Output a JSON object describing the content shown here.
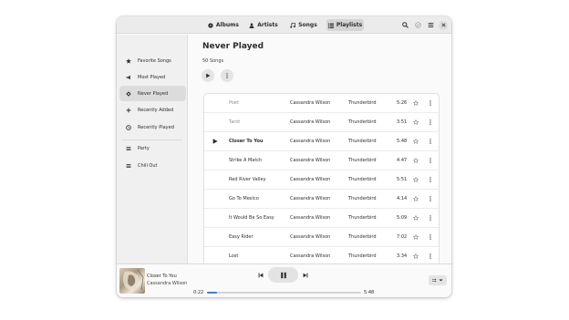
{
  "header": {
    "tabs": [
      {
        "label": "Albums",
        "icon": "album-icon"
      },
      {
        "label": "Artists",
        "icon": "artist-icon"
      },
      {
        "label": "Songs",
        "icon": "songs-icon"
      },
      {
        "label": "Playlists",
        "icon": "playlists-icon",
        "active": true
      }
    ]
  },
  "sidebar": {
    "items": [
      {
        "label": "Favorite Songs",
        "icon": "star-icon"
      },
      {
        "label": "Most Played",
        "icon": "megaphone-icon"
      },
      {
        "label": "Never Played",
        "icon": "diamond-icon",
        "active": true
      },
      {
        "label": "Recently Added",
        "icon": "plus-icon"
      },
      {
        "label": "Recently Played",
        "icon": "clock-icon"
      },
      {
        "label": "Party",
        "icon": "list-icon"
      },
      {
        "label": "Chill Out",
        "icon": "list-icon"
      }
    ]
  },
  "playlist": {
    "title": "Never Played",
    "count": "50 Songs"
  },
  "songs": [
    {
      "title": "Poet",
      "artist": "Cassandra Wilson",
      "album": "Thunderbird",
      "duration": "5:26",
      "state": "dim"
    },
    {
      "title": "Tarot",
      "artist": "Cassandra Wilson",
      "album": "Thunderbird",
      "duration": "3:51",
      "state": "dim"
    },
    {
      "title": "Closer To You",
      "artist": "Cassandra Wilson",
      "album": "Thunderbird",
      "duration": "5:48",
      "state": "playing"
    },
    {
      "title": "Strike A Match",
      "artist": "Cassandra Wilson",
      "album": "Thunderbird",
      "duration": "4:47",
      "state": ""
    },
    {
      "title": "Red River Valley",
      "artist": "Cassandra Wilson",
      "album": "Thunderbird",
      "duration": "5:51",
      "state": ""
    },
    {
      "title": "Go To Mexico",
      "artist": "Cassandra Wilson",
      "album": "Thunderbird",
      "duration": "4:14",
      "state": ""
    },
    {
      "title": "It Would Be So Easy",
      "artist": "Cassandra Wilson",
      "album": "Thunderbird",
      "duration": "5:09",
      "state": ""
    },
    {
      "title": "Easy Rider",
      "artist": "Cassandra Wilson",
      "album": "Thunderbird",
      "duration": "7:02",
      "state": ""
    },
    {
      "title": "Lost",
      "artist": "Cassandra Wilson",
      "album": "Thunderbird",
      "duration": "3:34",
      "state": ""
    }
  ],
  "player": {
    "title": "Closer To You",
    "artist": "Cassandra Wilson",
    "elapsed": "0:22",
    "total": "5:48",
    "progress": 0.063
  },
  "colors": {
    "accent": "#3584e4"
  }
}
